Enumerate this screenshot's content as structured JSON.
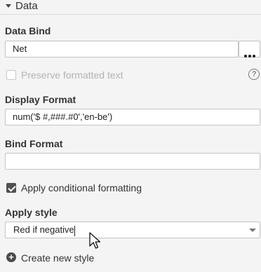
{
  "section": {
    "title": "Data"
  },
  "data_bind": {
    "label": "Data Bind",
    "value": "Net",
    "more_icon": "ellipsis-icon"
  },
  "preserve_formatted": {
    "label": "Preserve formatted text",
    "checked": false,
    "help_icon": "?"
  },
  "display_format": {
    "label": "Display Format",
    "value": "num('$ #,###.#0','en-be')"
  },
  "bind_format": {
    "label": "Bind Format",
    "value": ""
  },
  "conditional_formatting": {
    "label": "Apply conditional formatting",
    "checked": true
  },
  "apply_style": {
    "label": "Apply style",
    "value": "Red if negative"
  },
  "create_style": {
    "label": "Create new style",
    "icon": "+"
  }
}
